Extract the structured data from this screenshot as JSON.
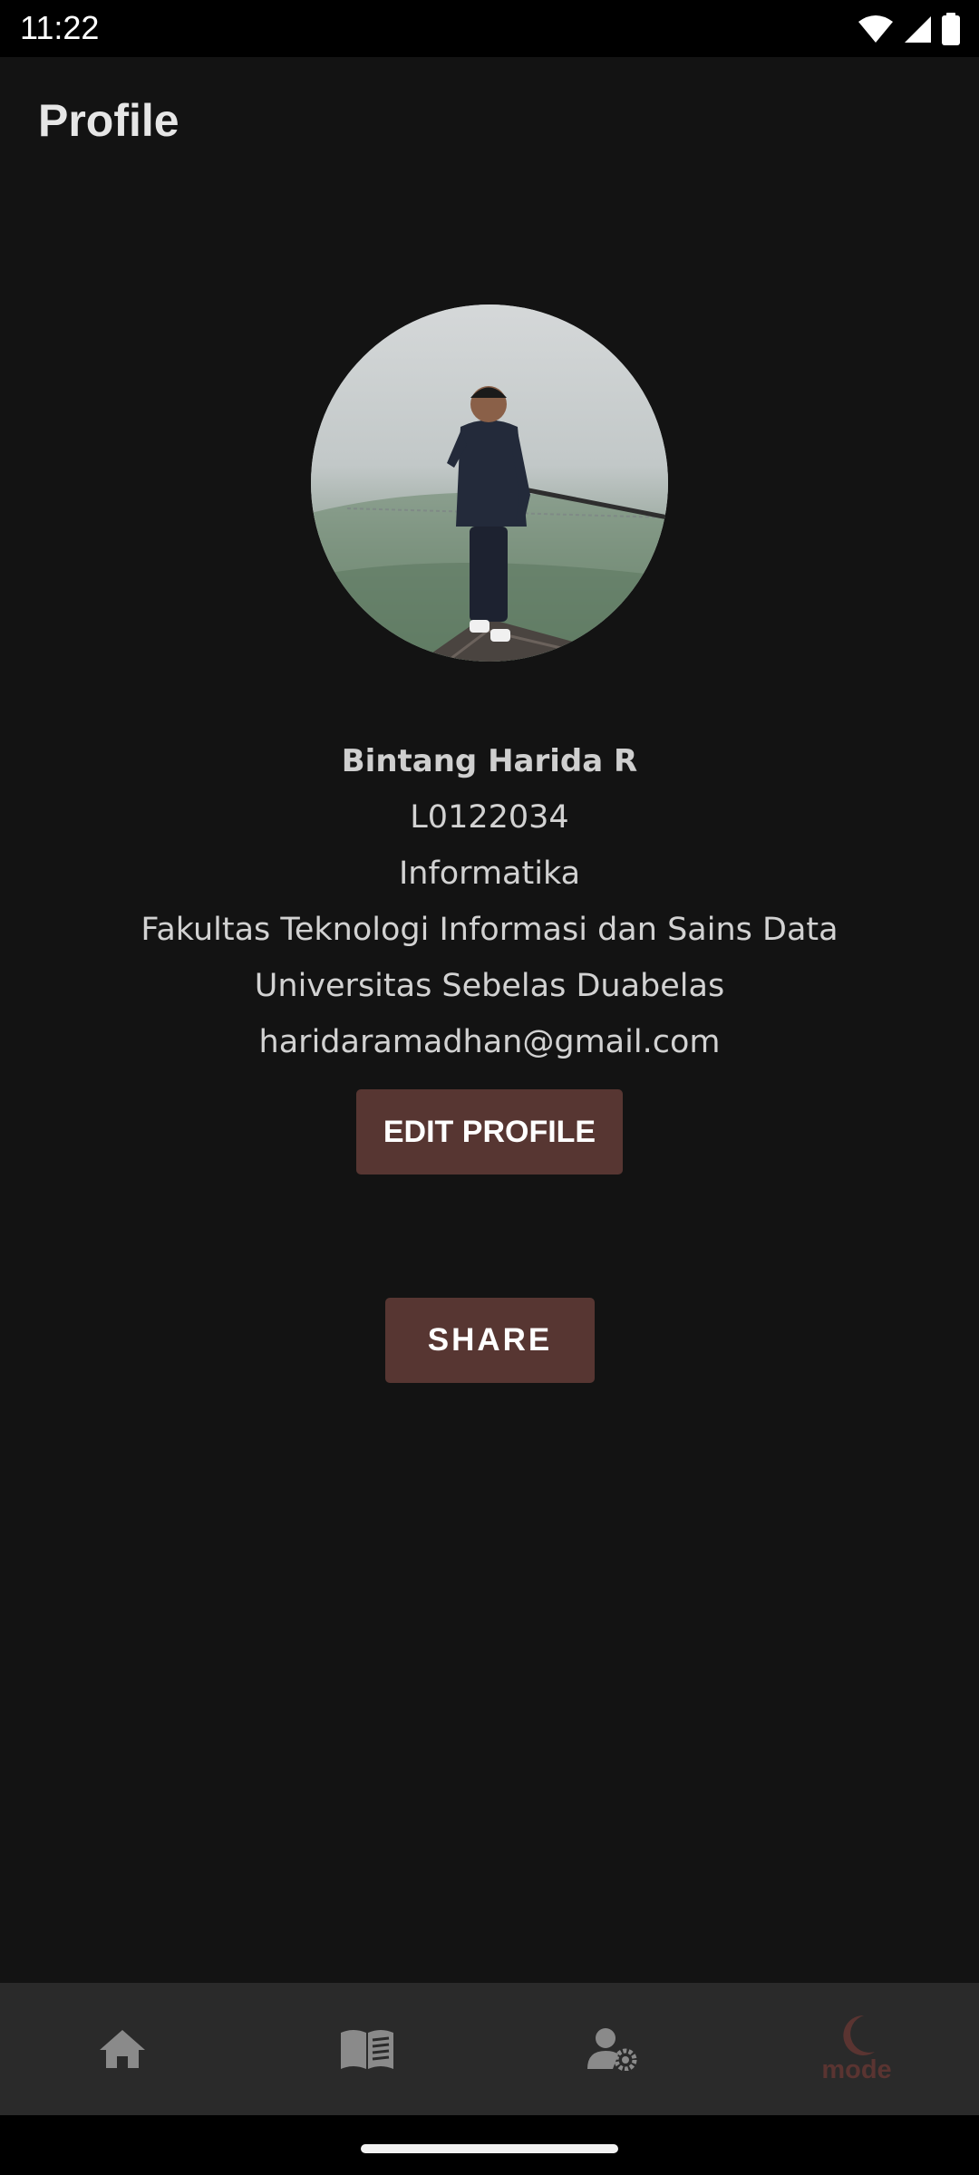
{
  "status_bar": {
    "time": "11:22",
    "icons": [
      "wifi-icon",
      "cellular-signal-icon",
      "battery-icon"
    ]
  },
  "page": {
    "title": "Profile"
  },
  "profile": {
    "photo_icon": "profile-photo",
    "name": "Bintang Harida R",
    "student_id": "L0122034",
    "major": "Informatika",
    "faculty": "Fakultas Teknologi Informasi dan Sains Data",
    "university": "Universitas Sebelas Duabelas",
    "email": "haridaramadhan@gmail.com"
  },
  "actions": {
    "edit_profile_label": "EDIT PROFILE",
    "share_label": "SHARE"
  },
  "bottom_nav": {
    "items": [
      {
        "icon": "home-icon",
        "label": ""
      },
      {
        "icon": "book-icon",
        "label": ""
      },
      {
        "icon": "user-settings-icon",
        "label": ""
      },
      {
        "icon": "moon-icon",
        "label": "mode"
      }
    ]
  },
  "colors": {
    "background": "#131313",
    "button": "#573632",
    "nav_background": "#2a2a2a",
    "nav_icon": "#8a8a8a",
    "accent": "#5a3431"
  }
}
